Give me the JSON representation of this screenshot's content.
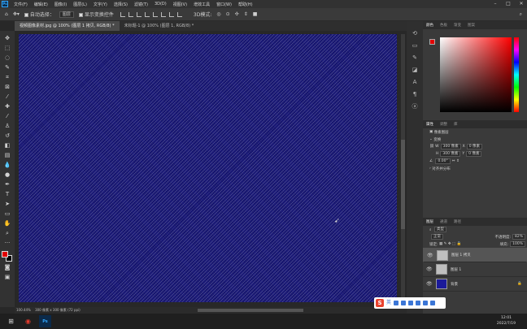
{
  "menubar": {
    "app_icon": "Ps",
    "items": [
      "文件(F)",
      "编辑(E)",
      "图像(I)",
      "图层(L)",
      "文字(Y)",
      "选择(S)",
      "滤镜(T)",
      "3D(D)",
      "视图(V)",
      "增效工具",
      "窗口(W)",
      "帮助(H)"
    ]
  },
  "options": {
    "auto_select_label": "自动选择：",
    "auto_select_value": "图层",
    "transform_label": "显示变换控件"
  },
  "tabs": [
    {
      "label": "视频图像素材.jpg @ 100% (图层 1 拷贝, RGB/8) *"
    },
    {
      "label": "未标题-1 @ 100% (图层 1, RGB/8) *"
    }
  ],
  "status": {
    "zoom": "100.44%",
    "doc_info": "300 像素 x 300 像素 (72 ppi)"
  },
  "panels": {
    "color_tabs": [
      "颜色",
      "色板",
      "渐变",
      "图案"
    ],
    "prop_tabs": [
      "属性",
      "调整",
      "库"
    ],
    "prop_title": "像素图层",
    "transform_label": "变换",
    "w_label": "W",
    "w_value": "300 像素",
    "x_label": "X",
    "x_value": "0 像素",
    "h_label": "H",
    "h_value": "300 像素",
    "y_label": "Y",
    "y_value": "0 像素",
    "angle": "0.00°",
    "align_label": "对齐并分布",
    "layer_tabs": [
      "图层",
      "通道",
      "路径"
    ],
    "filter": "类型",
    "blend": "正常",
    "opacity_label": "不透明度:",
    "opacity": "82%",
    "lock_label": "锁定:",
    "fill_label": "填充:",
    "fill": "100%",
    "layers": [
      {
        "name": "图层 1 拷贝",
        "selected": true,
        "thumb": "gray"
      },
      {
        "name": "图层 1",
        "selected": false,
        "thumb": "gray"
      },
      {
        "name": "背景",
        "selected": false,
        "thumb": "blue"
      }
    ]
  },
  "taskbar": {
    "time": "12:01",
    "date": "2022/7/19"
  },
  "ime": {
    "lang": "英"
  },
  "colors": {
    "canvas": "#1b1a7a",
    "foreground": "#e10000",
    "background": "#000000"
  }
}
